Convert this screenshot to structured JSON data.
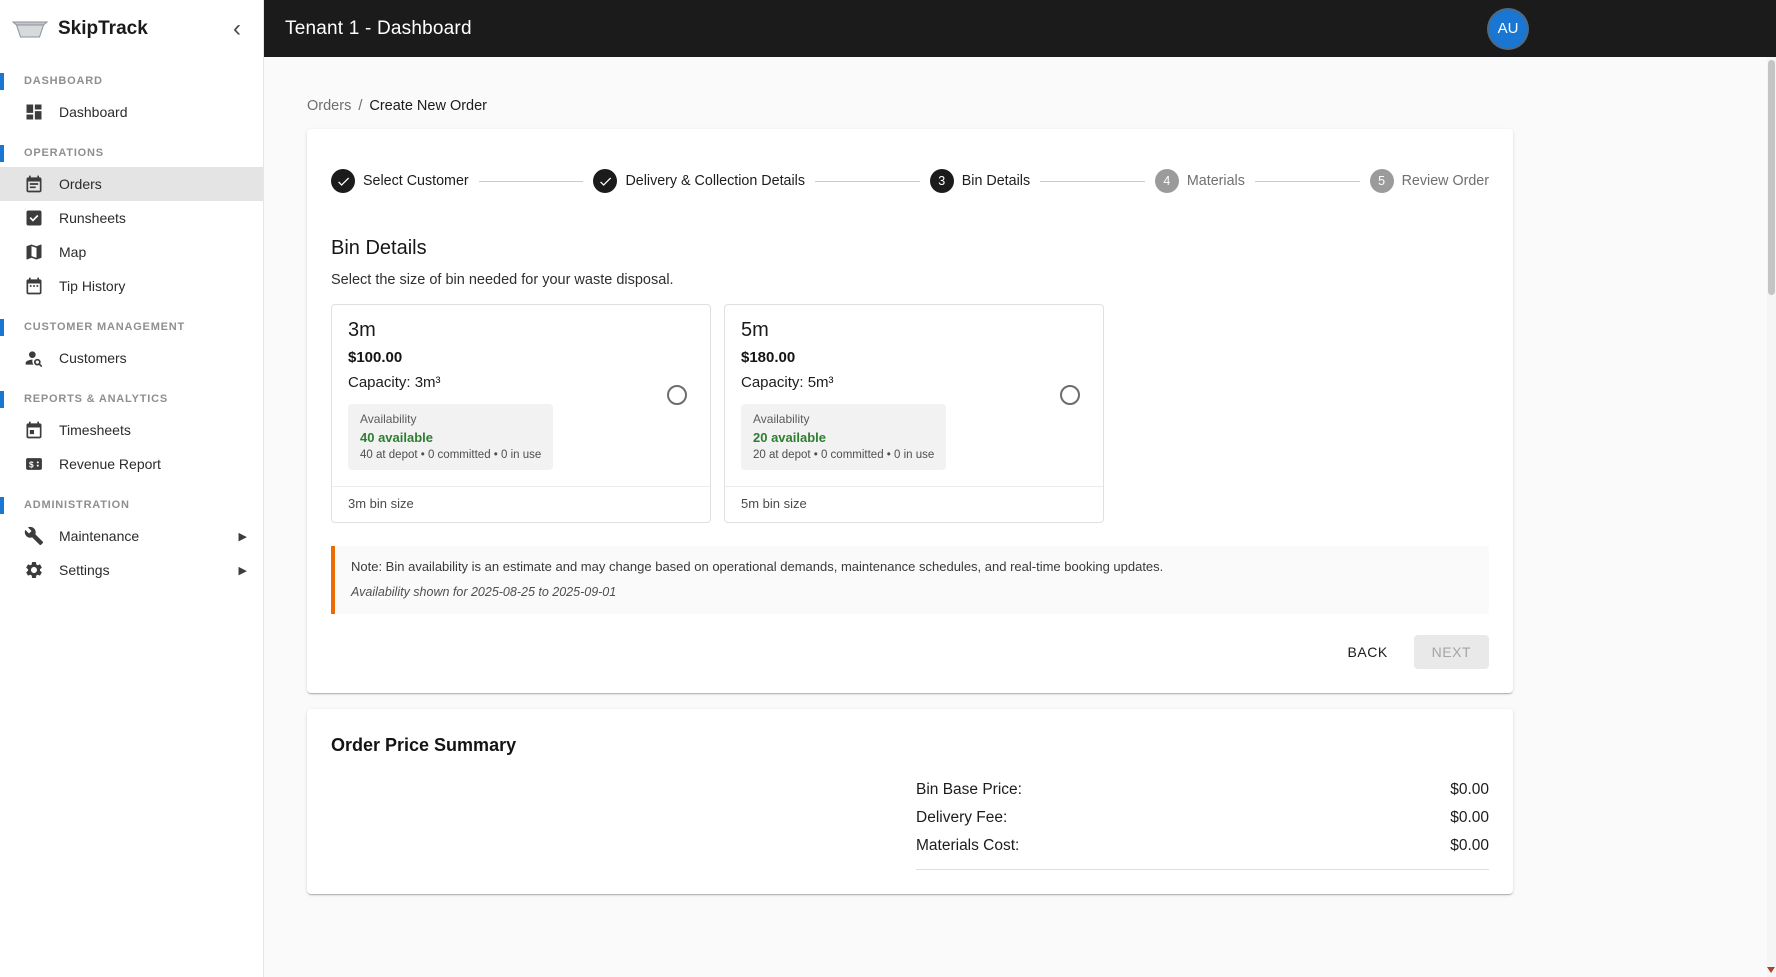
{
  "app": {
    "name": "SkipTrack",
    "collapse_icon": "‹",
    "expand_icon": "▶"
  },
  "topbar": {
    "title": "Tenant 1 - Dashboard",
    "avatar_initials": "AU"
  },
  "sidebar": {
    "sections": [
      {
        "label": "DASHBOARD",
        "items": [
          {
            "label": "Dashboard",
            "icon": "dashboard-icon",
            "active": false
          }
        ]
      },
      {
        "label": "OPERATIONS",
        "items": [
          {
            "label": "Orders",
            "icon": "orders-calendar-icon",
            "active": true
          },
          {
            "label": "Runsheets",
            "icon": "runsheets-task-icon",
            "active": false
          },
          {
            "label": "Map",
            "icon": "map-icon",
            "active": false
          },
          {
            "label": "Tip History",
            "icon": "tip-history-calendar-icon",
            "active": false
          }
        ]
      },
      {
        "label": "CUSTOMER MANAGEMENT",
        "items": [
          {
            "label": "Customers",
            "icon": "person-search-icon",
            "active": false
          }
        ]
      },
      {
        "label": "REPORTS & ANALYTICS",
        "items": [
          {
            "label": "Timesheets",
            "icon": "timesheets-calendar-icon",
            "active": false
          },
          {
            "label": "Revenue Report",
            "icon": "revenue-money-icon",
            "active": false
          }
        ]
      },
      {
        "label": "ADMINISTRATION",
        "items": [
          {
            "label": "Maintenance",
            "icon": "wrench-icon",
            "active": false,
            "expandable": true
          },
          {
            "label": "Settings",
            "icon": "gear-icon",
            "active": false,
            "expandable": true
          }
        ]
      }
    ]
  },
  "breadcrumb": {
    "parent": "Orders",
    "separator": "/",
    "current": "Create New Order"
  },
  "stepper": {
    "steps": [
      {
        "label": "Select Customer",
        "state": "completed"
      },
      {
        "label": "Delivery & Collection Details",
        "state": "completed"
      },
      {
        "label": "Bin Details",
        "state": "active",
        "number": "3"
      },
      {
        "label": "Materials",
        "state": "pending",
        "number": "4"
      },
      {
        "label": "Review Order",
        "state": "pending",
        "number": "5"
      }
    ]
  },
  "bin_details": {
    "heading": "Bin Details",
    "subtitle": "Select the size of bin needed for your waste disposal.",
    "options": [
      {
        "size": "3m",
        "price": "$100.00",
        "capacity": "Capacity: 3m³",
        "availability_label": "Availability",
        "available": "40 available",
        "breakdown": "40 at depot • 0 committed • 0 in use",
        "footer": "3m bin size",
        "selected": false
      },
      {
        "size": "5m",
        "price": "$180.00",
        "capacity": "Capacity: 5m³",
        "availability_label": "Availability",
        "available": "20 available",
        "breakdown": "20 at depot • 0 committed • 0 in use",
        "footer": "5m bin size",
        "selected": false
      }
    ],
    "note": "Note: Bin availability is an estimate and may change based on operational demands, maintenance schedules, and real-time booking updates.",
    "availability_period": "Availability shown for 2025-08-25 to 2025-09-01",
    "back_label": "BACK",
    "next_label": "NEXT"
  },
  "price_summary": {
    "title": "Order Price Summary",
    "rows": [
      {
        "label": "Bin Base Price:",
        "value": "$0.00"
      },
      {
        "label": "Delivery Fee:",
        "value": "$0.00"
      },
      {
        "label": "Materials Cost:",
        "value": "$0.00"
      }
    ]
  },
  "colors": {
    "accent_blue": "#1976d2",
    "success_green": "#2e7d32",
    "warning_orange": "#ed6c02",
    "topbar_bg": "#1b1b1b"
  }
}
